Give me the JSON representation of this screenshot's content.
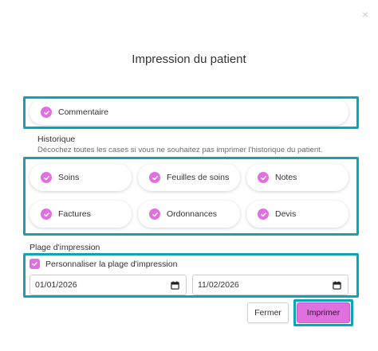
{
  "dialog": {
    "title": "Impression du patient",
    "close_glyph": "×"
  },
  "comment": {
    "label": "Commentaire",
    "checked": true
  },
  "history": {
    "heading": "Historique",
    "hint": "Décochez toutes les cases si vous ne souhaitez pas imprimer l'historique du patient.",
    "items": [
      {
        "label": "Soins",
        "checked": true
      },
      {
        "label": "Feuilles de soins",
        "checked": true
      },
      {
        "label": "Notes",
        "checked": true
      },
      {
        "label": "Factures",
        "checked": true
      },
      {
        "label": "Ordonnances",
        "checked": true
      },
      {
        "label": "Devis",
        "checked": true
      }
    ]
  },
  "range": {
    "heading": "Plage d'impression",
    "custom_label": "Personnaliser la plage d'impression",
    "custom_checked": true,
    "start_date": "01/01/2026",
    "end_date": "11/02/2026"
  },
  "buttons": {
    "close_label": "Fermer",
    "print_label": "Imprimer"
  },
  "colors": {
    "accent": "#e06fe0",
    "highlight": "#0fa3b8"
  },
  "icons": {
    "check": "check-icon",
    "calendar": "calendar-icon",
    "close": "close-icon"
  }
}
